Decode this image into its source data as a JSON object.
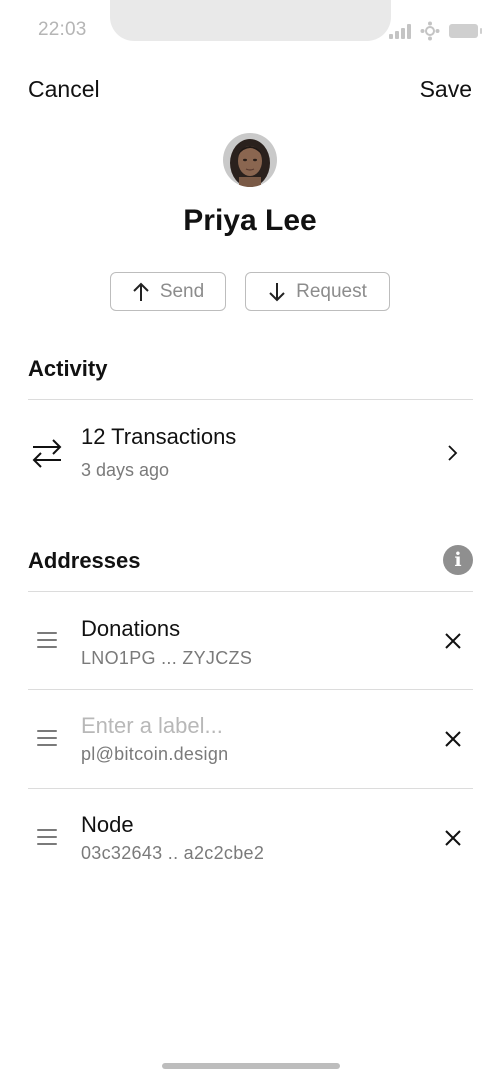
{
  "status_bar": {
    "time": "22:03"
  },
  "nav": {
    "cancel_label": "Cancel",
    "save_label": "Save"
  },
  "contact": {
    "name": "Priya Lee"
  },
  "actions": {
    "send_label": "Send",
    "request_label": "Request"
  },
  "activity": {
    "title": "Activity",
    "transactions_label": "12 Transactions",
    "last_activity": "3 days ago"
  },
  "addresses": {
    "title": "Addresses",
    "items": [
      {
        "label": "Donations",
        "value": "LNO1PG ... ZYJCZS"
      },
      {
        "label": "",
        "placeholder": "Enter a label...",
        "value": "pl@bitcoin.design"
      },
      {
        "label": "Node",
        "value": "03c32643 .. a2c2cbe2"
      }
    ]
  },
  "icons": {
    "send": "arrow-up-icon",
    "request": "arrow-down-icon",
    "activity": "transfer-arrows-icon",
    "chevron": "chevron-right-icon",
    "info": "info-icon",
    "drag": "drag-handle-icon",
    "remove": "close-icon"
  },
  "colors": {
    "accent_gray": "#8f8f8f",
    "secondary_text": "#7a7a7a",
    "placeholder": "#b8b8b8"
  }
}
